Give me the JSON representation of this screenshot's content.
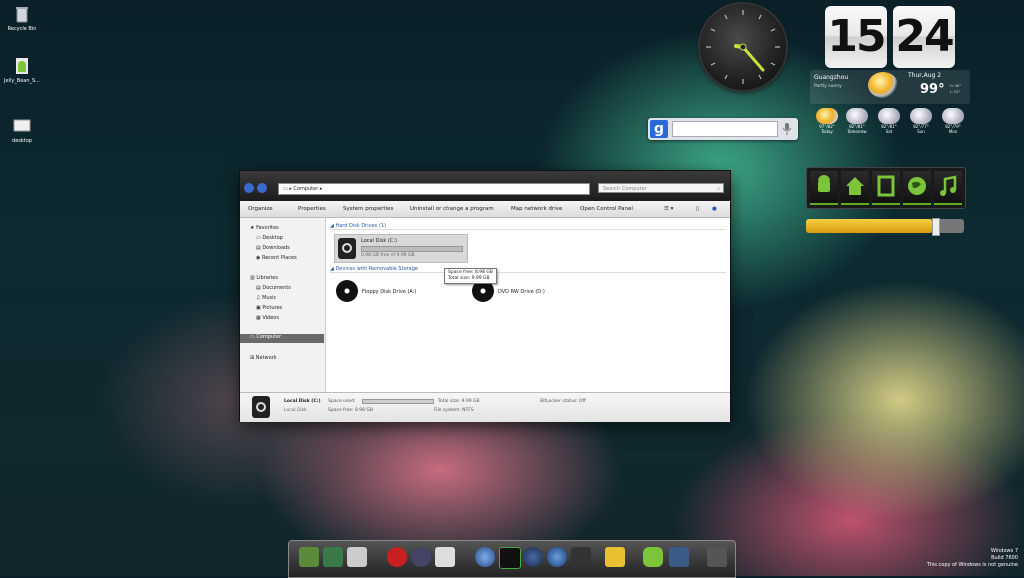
{
  "desktop_icons": [
    {
      "label": "Recycle Bin"
    },
    {
      "label": "Jelly_Bean_S..."
    },
    {
      "label": "desktop"
    }
  ],
  "flip_clock": {
    "hours": "15",
    "minutes": "24",
    "city": "Guangzhou",
    "condition": "Partly sunny",
    "date": "Thur,Aug 2",
    "temp": "99°",
    "hi": "H: 98°",
    "lo": "L: 82°"
  },
  "forecast": [
    {
      "day": "Today",
      "temp": "97°/82°"
    },
    {
      "day": "Tomorrow",
      "temp": "82°/81°"
    },
    {
      "day": "Sat",
      "temp": "82°/81°"
    },
    {
      "day": "Sun",
      "temp": "82°/77°"
    },
    {
      "day": "Mon",
      "temp": "82°/79°"
    }
  ],
  "google_search": {
    "logo": "g"
  },
  "launcher": {
    "buttons": [
      "android-icon",
      "home-icon",
      "browser-icon",
      "globe-icon",
      "music-icon"
    ]
  },
  "explorer": {
    "address": "Computer",
    "search_placeholder": "Search Computer",
    "toolbar": [
      "Organize",
      "Properties",
      "System properties",
      "Uninstall or change a program",
      "Map network drive",
      "Open Control Panel"
    ],
    "nav": {
      "favorites": "Favorites",
      "desktop": "Desktop",
      "downloads": "Downloads",
      "recent": "Recent Places",
      "libraries": "Libraries",
      "documents": "Documents",
      "music": "Music",
      "pictures": "Pictures",
      "videos": "Videos",
      "computer": "Computer",
      "network": "Network"
    },
    "hdd_group": "Hard Disk Drives (1)",
    "local_disk": {
      "name": "Local Disk (C:)",
      "free": "0.98 GB free of 9.99 GB"
    },
    "removable_group": "Devices with Removable Storage",
    "tooltip": [
      "Space free: 8.98 GB",
      "Total size: 9.99 GB"
    ],
    "floppy": "Floppy Disk Drive (A:)",
    "dvd": "DVD RW Drive (D:)",
    "details": {
      "name": "Local Disk (C:)",
      "type": "Local Disk",
      "used_label": "Space used:",
      "free_label": "Space free: 8.98 GB",
      "total": "Total size: 9.99 GB",
      "fs": "File system: NTFS",
      "bitlocker": "BitLocker status: Off"
    }
  },
  "watermark": [
    "Windows 7",
    "Build 7600",
    "This copy of Windows is not genuine"
  ],
  "colors": {
    "accent_green": "#5fae1e",
    "slider_fill": "#e6b21a"
  },
  "slider_level": 0.8
}
